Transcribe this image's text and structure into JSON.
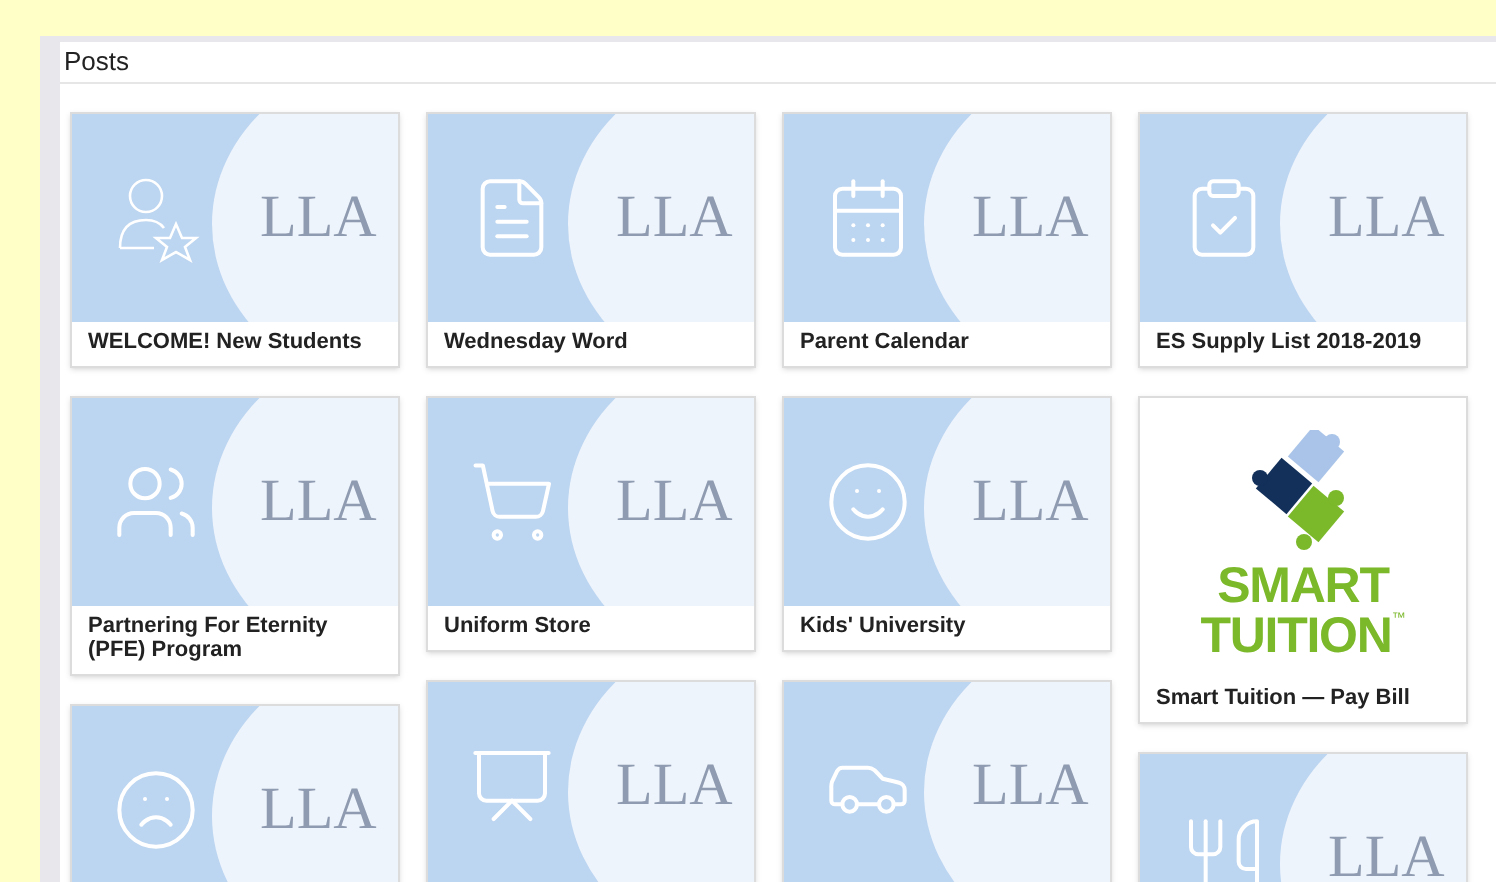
{
  "panel": {
    "title": "Posts"
  },
  "columns": [
    [
      {
        "kind": "tile",
        "logo": "LLA",
        "caption": "WELCOME! New Students"
      },
      {
        "kind": "tile",
        "logo": "LLA",
        "caption": "Partnering For Eternity (PFE) Program"
      },
      {
        "kind": "tile",
        "logo": "LLA"
      }
    ],
    [
      {
        "kind": "tile",
        "logo": "LLA",
        "caption": "Wednesday Word"
      },
      {
        "kind": "tile",
        "logo": "LLA",
        "caption": "Uniform Store"
      },
      {
        "kind": "tile",
        "logo": "LLA"
      }
    ],
    [
      {
        "kind": "tile",
        "logo": "LLA",
        "caption": "Parent Calendar"
      },
      {
        "kind": "tile",
        "logo": "LLA",
        "caption": "Kids' University"
      },
      {
        "kind": "tile",
        "logo": "LLA"
      }
    ],
    [
      {
        "kind": "tile",
        "logo": "LLA",
        "caption": "ES Supply List 2018-2019"
      },
      {
        "kind": "brand",
        "brand_line_1": "SMART",
        "brand_line_2": "TUITION",
        "brand_mark": "™",
        "caption": "Smart Tuition — Pay Bill"
      },
      {
        "kind": "tile",
        "logo": "LLA"
      }
    ]
  ]
}
